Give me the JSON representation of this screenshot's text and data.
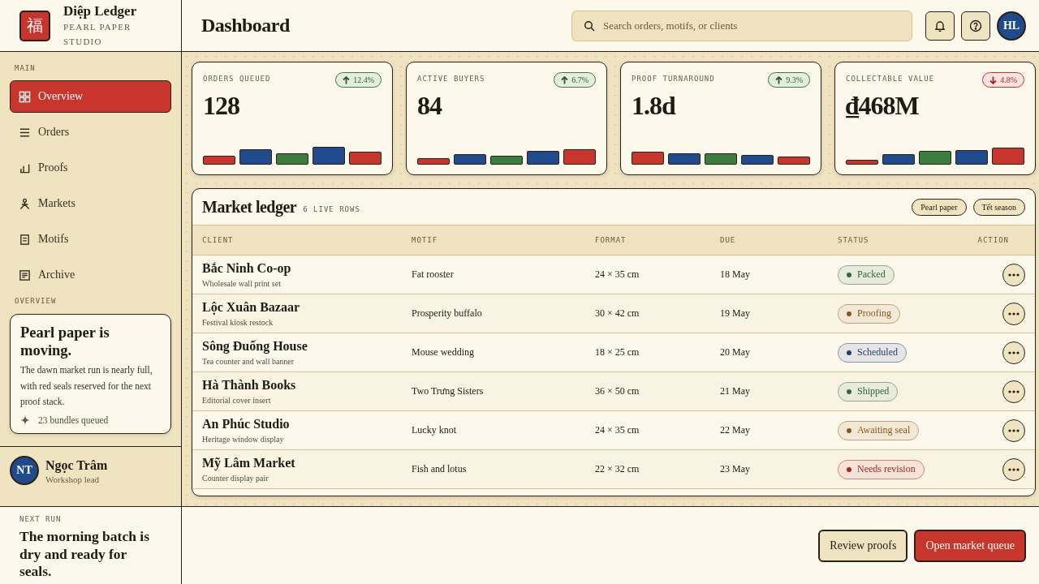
{
  "brand": {
    "mark": "福",
    "name": "Diệp Ledger",
    "tagline": "PEARL PAPER STUDIO"
  },
  "header": {
    "title": "Dashboard",
    "search": {
      "placeholder": "Search orders, motifs, or clients"
    },
    "avatar_initials": "HL"
  },
  "sidebar": {
    "section_label": "MAIN",
    "items": [
      {
        "label": "Overview",
        "selected": true
      },
      {
        "label": "Orders",
        "selected": false
      },
      {
        "label": "Proofs",
        "selected": false
      },
      {
        "label": "Markets",
        "selected": false
      },
      {
        "label": "Motifs",
        "selected": false
      },
      {
        "label": "Archive",
        "selected": false
      }
    ],
    "overview_label": "OVERVIEW",
    "overview_card": {
      "title": "Pearl paper is moving.",
      "body": "The dawn market run is nearly full, with red seals reserved for the next proof stack.",
      "footnote": "23 bundles queued"
    },
    "user": {
      "initials": "NT",
      "name": "Ngọc Trâm",
      "role": "Workshop lead"
    }
  },
  "kpis": [
    {
      "label": "ORDERS QUEUED",
      "value": "128",
      "delta": "12.4%",
      "rising": true
    },
    {
      "label": "ACTIVE BUYERS",
      "value": "84",
      "delta": "6.7%",
      "rising": true
    },
    {
      "label": "PROOF TURNAROUND",
      "value": "1.8d",
      "delta": "9.3%",
      "rising": true
    },
    {
      "label": "COLLECTABLE VALUE",
      "value": "₫468M",
      "delta": "4.8%",
      "rising": false
    }
  ],
  "table": {
    "title": "Market ledger",
    "count": "6 LIVE ROWS",
    "tags": [
      "Pearl paper",
      "Tết season"
    ],
    "columns": [
      "CLIENT",
      "MOTIF",
      "FORMAT",
      "DUE",
      "STATUS",
      "ACTION"
    ],
    "rows": [
      {
        "client": "Bắc Ninh Co-op",
        "note": "Wholesale wall print set",
        "motif": "Fat rooster",
        "format": "24 × 35 cm",
        "due": "18 May",
        "status": {
          "label": "Packed",
          "color": "#2f6a35"
        }
      },
      {
        "client": "Lộc Xuân Bazaar",
        "note": "Festival kiosk restock",
        "motif": "Prosperity buffalo",
        "format": "30 × 42 cm",
        "due": "19 May",
        "status": {
          "label": "Proofing",
          "color": "#8a5a14"
        }
      },
      {
        "client": "Sông Đuống House",
        "note": "Tea counter and wall banner",
        "motif": "Mouse wedding",
        "format": "18 × 25 cm",
        "due": "20 May",
        "status": {
          "label": "Scheduled",
          "color": "#1f3f7a"
        }
      },
      {
        "client": "Hà Thành Books",
        "note": "Editorial cover insert",
        "motif": "Two Trưng Sisters",
        "format": "36 × 50 cm",
        "due": "21 May",
        "status": {
          "label": "Shipped",
          "color": "#2f6a35"
        }
      },
      {
        "client": "An Phúc Studio",
        "note": "Heritage window display",
        "motif": "Lucky knot",
        "format": "24 × 35 cm",
        "due": "22 May",
        "status": {
          "label": "Awaiting seal",
          "color": "#8a5a14"
        }
      },
      {
        "client": "Mỹ Lâm Market",
        "note": "Counter display pair",
        "motif": "Fish and lotus",
        "format": "22 × 32 cm",
        "due": "23 May",
        "status": {
          "label": "Needs revision",
          "color": "#a8261f"
        }
      }
    ]
  },
  "next_run": {
    "label": "NEXT RUN",
    "text": "The morning batch is dry and ready for seals."
  },
  "actions": [
    {
      "label": "Review proofs",
      "kind": "secondary"
    },
    {
      "label": "Open market queue",
      "kind": "primary"
    }
  ]
}
